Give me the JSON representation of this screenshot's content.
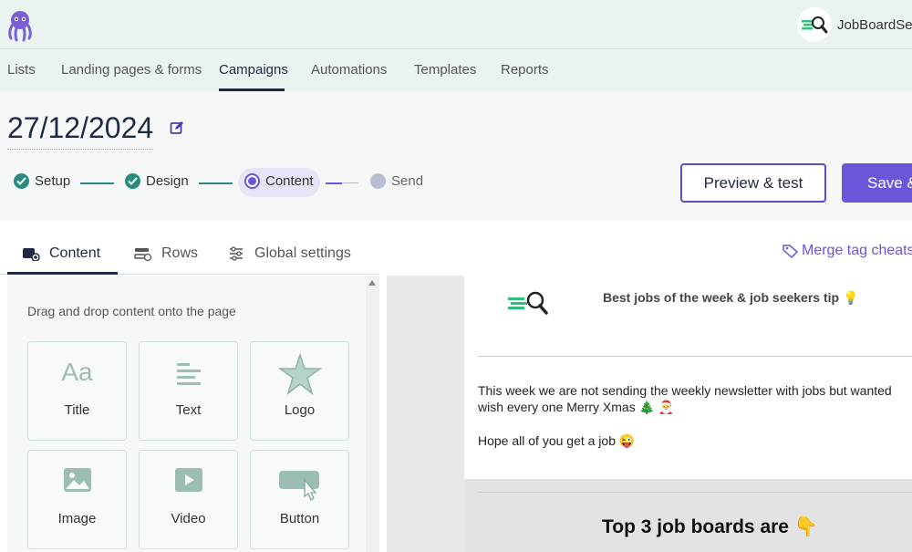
{
  "account": {
    "name": "JobBoardSea"
  },
  "nav": [
    "Lists",
    "Landing pages & forms",
    "Campaigns",
    "Automations",
    "Templates",
    "Reports"
  ],
  "campaign": {
    "title": "27/12/2024"
  },
  "steps": {
    "setup": "Setup",
    "design": "Design",
    "content": "Content",
    "send": "Send"
  },
  "actions": {
    "preview": "Preview & test",
    "save": "Save &"
  },
  "tabs": {
    "content": "Content",
    "rows": "Rows",
    "global": "Global settings"
  },
  "merge_tags": "Merge tag cheats",
  "panel": {
    "hint": "Drag and drop content onto the page",
    "tiles": [
      "Title",
      "Text",
      "Logo",
      "Image",
      "Video",
      "Button"
    ],
    "title_glyph": "Aa"
  },
  "email": {
    "heading": "Best jobs of the week & job seekers tip 💡",
    "line1": "This week we are not sending the weekly newsletter with jobs but wanted",
    "line2": "wish every one Merry Xmas 🎄 🎅",
    "line3": "Hope all of you get a job 😜",
    "section_title": "Top 3 job boards are 👇"
  },
  "colors": {
    "accent": "#6b55d8",
    "teal": "#2a8a80",
    "navy": "#1f2a44",
    "topbar": "#e9f3f0"
  }
}
